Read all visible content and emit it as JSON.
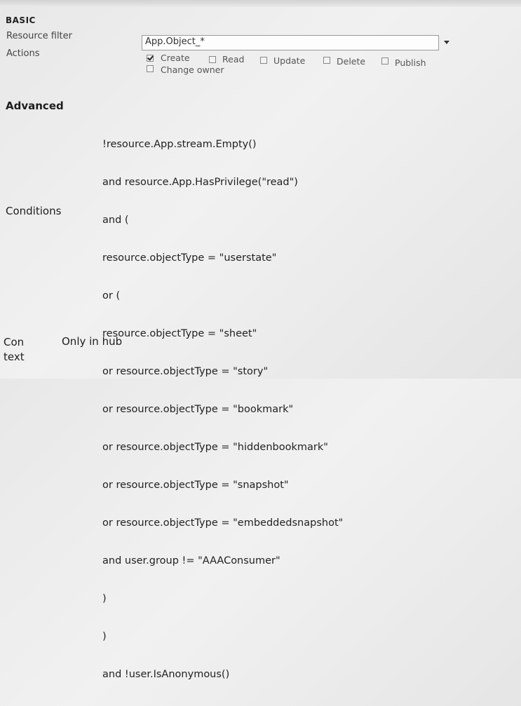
{
  "basic": {
    "heading": "BASIC",
    "resource_filter_label": "Resource filter",
    "resource_filter_value": "App.Object_*",
    "actions_label": "Actions",
    "actions": [
      {
        "label": "Create",
        "checked": true
      },
      {
        "label": "Read",
        "checked": false
      },
      {
        "label": "Update",
        "checked": false
      },
      {
        "label": "Delete",
        "checked": false
      },
      {
        "label": "Publish",
        "checked": false
      },
      {
        "label": "Change owner",
        "checked": false
      }
    ]
  },
  "advanced": {
    "heading": "Advanced",
    "conditions_label": "Conditions",
    "conditions_lines": [
      "!resource.App.stream.Empty()",
      "and resource.App.HasPrivilege(\"read\")",
      "and (",
      "resource.objectType = \"userstate\"",
      "or (",
      "resource.objectType = \"sheet\"",
      "or resource.objectType = \"story\"",
      "or resource.objectType = \"bookmark\"",
      "or resource.objectType = \"hiddenbookmark\"",
      "or resource.objectType = \"snapshot\"",
      "or resource.objectType = \"embeddedsnapshot\"",
      "and user.group != \"AAAConsumer\"",
      ")",
      ")",
      "and !user.IsAnonymous()"
    ]
  },
  "context": {
    "label_line1": "Con",
    "label_line2": "text",
    "value": "Only in hub"
  }
}
